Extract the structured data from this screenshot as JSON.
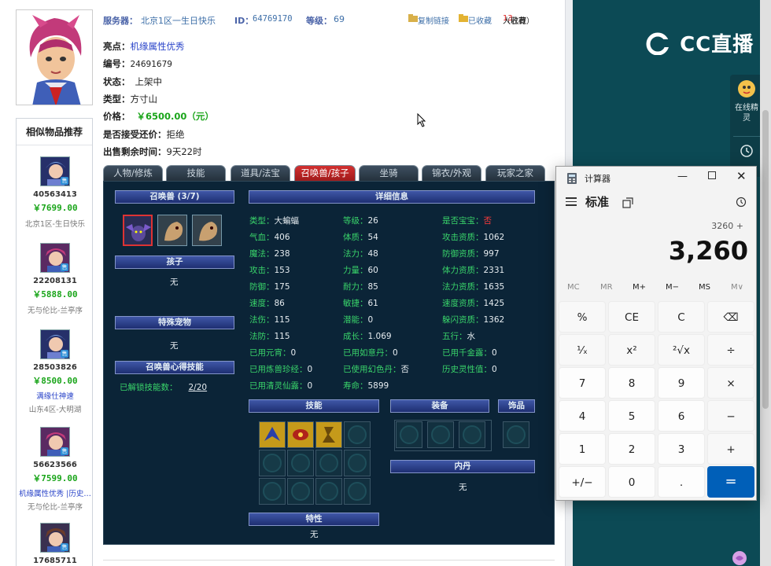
{
  "listing": {
    "server_label": "服务器：",
    "server_value": "北京1区一生日快乐",
    "id_label": "ID：",
    "id_value": "64769170",
    "level_label": "等级：",
    "level_value": "69",
    "copy_link": "复制链接",
    "collected": "已收藏",
    "collect_count_pre": "（已有",
    "collect_count": "13",
    "collect_count_post": "人收藏）",
    "highlight_label": "亮点：",
    "highlight_value": "机缘属性优秀",
    "number_label": "编号：",
    "number_value": "24691679",
    "status_label": "状态：",
    "status_value": "上架中",
    "type_label": "类型：",
    "type_value": "方寸山",
    "price_label": "价格：",
    "price_value": "￥6500.00（元）",
    "bargain_label": "是否接受还价：",
    "bargain_value": "拒绝",
    "remain_label": "出售剩余时间：",
    "remain_value": "9天22时"
  },
  "similar": {
    "title": "相似物品推荐",
    "sell_badge": "售",
    "items": [
      {
        "id": "40563413",
        "price": "￥7699.00",
        "tag": "",
        "server": "北京1区-生日快乐"
      },
      {
        "id": "22208131",
        "price": "￥5888.00",
        "tag": "",
        "server": "无与伦比-兰亭序"
      },
      {
        "id": "28503826",
        "price": "￥8500.00",
        "tag": "满缘仕神速",
        "server": "山东4区-大明湖"
      },
      {
        "id": "56623566",
        "price": "￥7599.00",
        "tag": "机缘属性优秀 |历史…",
        "server": "无与伦比-兰亭序"
      },
      {
        "id": "17685711",
        "price": "",
        "tag": "",
        "server": ""
      }
    ]
  },
  "tabs": [
    "人物/修炼",
    "技能",
    "道具/法宝",
    "召唤兽/孩子",
    "坐骑",
    "锦衣/外观",
    "玩家之家"
  ],
  "active_tab": 3,
  "summon": {
    "pets_header": "召唤兽 (3/7)",
    "detail_header": "详细信息",
    "child_header": "孩子",
    "child_value": "无",
    "special_header": "特殊宠物",
    "special_value": "无",
    "heart_header": "召唤兽心得技能",
    "unlock_label": "已解锁技能数：",
    "unlock_value": "2/20",
    "skills_header": "技能",
    "equip_header": "装备",
    "accessory_header": "饰品",
    "inner_header": "内丹",
    "inner_value": "无",
    "trait_header": "特性",
    "trait_value": "无",
    "stats": [
      [
        "类型：",
        "大蝙蝠",
        "等级：",
        "26",
        "是否宝宝：",
        "否"
      ],
      [
        "气血：",
        "406",
        "体质：",
        "54",
        "攻击资质：",
        "1062"
      ],
      [
        "魔法：",
        "238",
        "法力：",
        "48",
        "防御资质：",
        "997"
      ],
      [
        "攻击：",
        "153",
        "力量：",
        "60",
        "体力资质：",
        "2331"
      ],
      [
        "防御：",
        "175",
        "耐力：",
        "85",
        "法力资质：",
        "1635"
      ],
      [
        "速度：",
        "86",
        "敏捷：",
        "61",
        "速度资质：",
        "1425"
      ],
      [
        "法伤：",
        "115",
        "潜能：",
        "0",
        "躲闪资质：",
        "1362"
      ],
      [
        "法防：",
        "115",
        "成长：",
        "1.069",
        "五行：",
        "水"
      ],
      [
        "已用元宵：",
        "0",
        "已用如意丹：",
        "0",
        "已用千金露：",
        "0"
      ],
      [
        "已用炼兽珍经：",
        "0",
        "已使用幻色丹：",
        "否",
        "历史灵性值：",
        "0"
      ],
      [
        "已用清灵仙露：",
        "0",
        "寿命：",
        "5899",
        "",
        ""
      ]
    ]
  },
  "calculator": {
    "title": "计算器",
    "mode": "标准",
    "expression": "3260 +",
    "display": "3,260",
    "memory": [
      "MC",
      "MR",
      "M+",
      "M−",
      "MS",
      "M∨"
    ],
    "keys": [
      [
        "%",
        "CE",
        "C",
        "⌫"
      ],
      [
        "¹⁄ₓ",
        "x²",
        "²√x",
        "÷"
      ],
      [
        "7",
        "8",
        "9",
        "×"
      ],
      [
        "4",
        "5",
        "6",
        "−"
      ],
      [
        "1",
        "2",
        "3",
        "+"
      ],
      [
        "+/−",
        "0",
        ".",
        "="
      ]
    ]
  },
  "cc": {
    "logo": "CC直播",
    "side_label": "在线精灵"
  }
}
